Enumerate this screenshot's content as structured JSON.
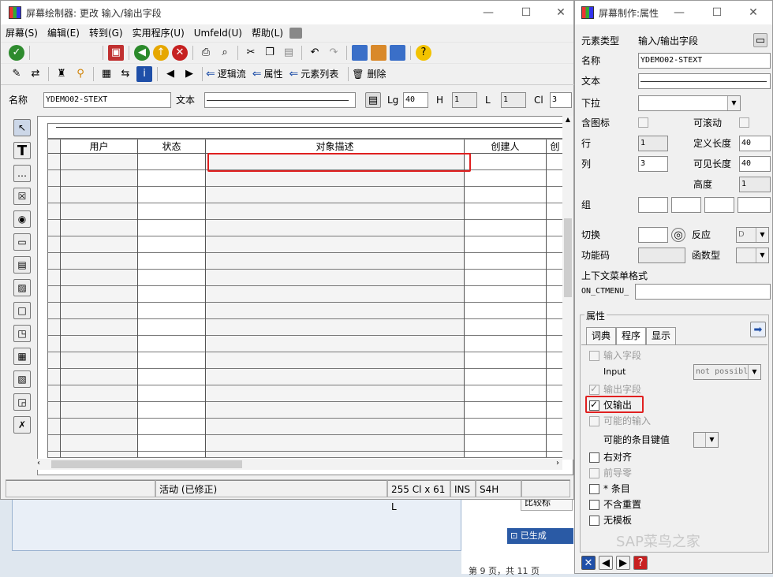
{
  "main_window": {
    "title": "屏幕绘制器: 更改 输入/输出字段",
    "menu": [
      "屏幕(S)",
      "编辑(E)",
      "转到(G)",
      "实用程序(U)",
      "Umfeld(U)",
      "帮助(L)"
    ],
    "toolbar2": {
      "logic": "逻辑流",
      "attributes": "属性",
      "element_list": "元素列表",
      "delete": "删除"
    },
    "name_label": "名称",
    "name_value": "YDEMO02-STEXT",
    "text_label": "文本",
    "lg_label": "Lg",
    "lg_value": "40",
    "h_label": "H",
    "h_value": "1",
    "l_label": "L",
    "l_value": "1",
    "cl_label": "Cl",
    "cl_value": "3",
    "grid_columns": [
      "用户",
      "状态",
      "对象描述",
      "创建人",
      "创"
    ],
    "status": {
      "mode": "活动 (已修正)",
      "pos": "255 Cl x 61 L",
      "ins": "INS",
      "sys": "S4H"
    }
  },
  "background": {
    "btn1": "比较标",
    "btn2": "已生成",
    "page": "第 9 页，共 11 页"
  },
  "props": {
    "title": "屏幕制作:属性",
    "element_type_label": "元素类型",
    "element_type_value": "输入/输出字段",
    "name_label": "名称",
    "name_value": "YDEMO02-STEXT",
    "text_label": "文本",
    "dropdown_label": "下拉",
    "with_icon_label": "含图标",
    "scrollable_label": "可滚动",
    "row_label": "行",
    "row_value": "1",
    "def_len_label": "定义长度",
    "def_len_value": "40",
    "col_label": "列",
    "col_value": "3",
    "vis_len_label": "可见长度",
    "vis_len_value": "40",
    "height_label": "高度",
    "height_value": "1",
    "group_label": "组",
    "switch_label": "切换",
    "react_label": "反应",
    "react_value": "D",
    "fcode_label": "功能码",
    "ftype_label": "函数型",
    "ctx_label": "上下文菜单格式",
    "ctx_prefix": "ON_CTMENU_",
    "attr_group": "属性",
    "tabs": [
      "词典",
      "程序",
      "显示"
    ],
    "input_field": "输入字段",
    "input_label": "Input",
    "input_value": "not possibl",
    "output_field": "输出字段",
    "output_only": "仅输出",
    "possible_input": "可能的输入",
    "possible_entry_key": "可能的条目键值",
    "right_align": "右对齐",
    "leading_zero": "前导零",
    "star_entry": "* 条目",
    "no_repeat": "不含重置",
    "no_template": "无模板",
    "watermark": "SAP菜鸟之家"
  }
}
